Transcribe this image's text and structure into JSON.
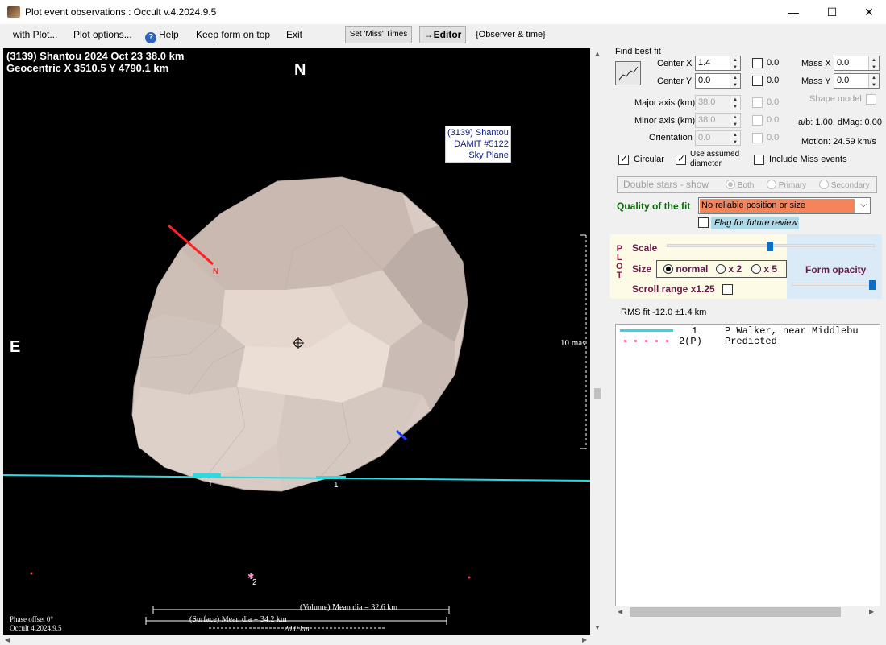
{
  "window": {
    "title": "Plot event observations : Occult v.4.2024.9.5",
    "controls": {
      "minimize": "—",
      "maximize": "☐",
      "close": "✕"
    }
  },
  "menu": {
    "with_plot": "with Plot...",
    "plot_options": "Plot options...",
    "help": "Help",
    "keep_on_top": "Keep form on top",
    "exit": "Exit",
    "set_miss_times": "Set 'Miss' Times",
    "editor": "→Editor",
    "observer_time": "{Observer & time}"
  },
  "plot": {
    "heading_line1": "(3139) Shantou  2024 Oct 23   38.0 km",
    "heading_line2": "Geocentric X  3510.5  Y 4790.1 km",
    "north": "N",
    "east": "E",
    "model_label_line1": "(3139) Shantou",
    "model_label_line2": "DAMIT #5122",
    "model_label_line3": "Sky Plane",
    "north_pole_label": "N",
    "chord1_label_a": "1",
    "chord1_label_b": "1",
    "star_label": "2",
    "scale_label": "10 mas",
    "phase_offset": "Phase offset 0°",
    "version": "Occult 4.2024.9.5",
    "volume_mean": "(Volume) Mean dia = 32.6 km",
    "surface_mean": "(Surface) Mean dia = 34.2 km",
    "scale_km": "20.0 km",
    "colors": {
      "chord": "#30d8e0",
      "pole": "#ff2020",
      "south_pole": "#2040ff",
      "shape": "#d8c8c0"
    }
  },
  "fit": {
    "group_label": "Find best fit",
    "center_x_label": "Center X",
    "center_x_value": "1.4",
    "center_y_label": "Center Y",
    "center_y_value": "0.0",
    "cx_check_value": "0.0",
    "cy_check_value": "0.0",
    "mass_x_label": "Mass X",
    "mass_x_value": "0.0",
    "mass_y_label": "Mass Y",
    "mass_y_value": "0.0",
    "major_label": "Major axis (km)",
    "major_value": "38.0",
    "minor_label": "Minor axis (km)",
    "minor_value": "38.0",
    "orient_label": "Orientation",
    "orient_value": "0.0",
    "major_check_value": "0.0",
    "minor_check_value": "0.0",
    "orient_check_value": "0.0",
    "shape_model": "Shape model",
    "ab_dmag": "a/b: 1.00, dMag: 0.00",
    "motion": "Motion: 24.59 km/s",
    "circular": "Circular",
    "use_assumed_1": "Use assumed",
    "use_assumed_2": "diameter",
    "include_miss": "Include Miss events"
  },
  "double_stars": {
    "label": "Double stars - show",
    "both": "Both",
    "primary": "Primary",
    "secondary": "Secondary"
  },
  "quality": {
    "label": "Quality of the fit",
    "value": "No reliable position or size",
    "flag_review": "Flag for future review"
  },
  "plot_controls": {
    "vertical_label": [
      "P",
      "L",
      "O",
      "T"
    ],
    "scale": "Scale",
    "scale_level": 0.5,
    "size": "Size",
    "normal": "normal",
    "x2": "x 2",
    "x5": "x 5",
    "form_opacity": "Form opacity",
    "opacity_level": 1.0,
    "scroll_range": "Scroll range x1.25"
  },
  "rms": "RMS fit -12.0 ±1.4 km",
  "legend": {
    "rows": [
      {
        "id": "1",
        "text": "P Walker, near Middlebu",
        "color": "#30d8e0",
        "style": "solid"
      },
      {
        "id": "2(P)",
        "text": "Predicted",
        "color": "#ff6fb0",
        "style": "dotted"
      }
    ]
  }
}
